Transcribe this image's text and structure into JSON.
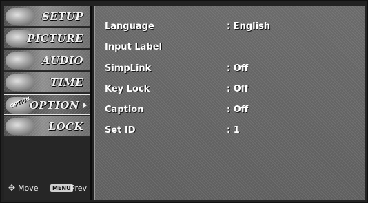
{
  "sidebar": {
    "items": [
      {
        "label": "SETUP"
      },
      {
        "label": "PICTURE"
      },
      {
        "label": "AUDIO"
      },
      {
        "label": "TIME"
      },
      {
        "label": "OPTION",
        "active": true,
        "thumb_text": "OPTION"
      },
      {
        "label": "LOCK"
      }
    ],
    "hints": {
      "move_label": "Move",
      "menu_key": "MENU",
      "prev_label": "Prev"
    }
  },
  "settings": [
    {
      "label": "Language",
      "value": ": English"
    },
    {
      "label": "Input Label",
      "value": ""
    },
    {
      "label": "SimpLink",
      "value": ": Off"
    },
    {
      "label": "Key Lock",
      "value": ": Off"
    },
    {
      "label": "Caption",
      "value": ": Off"
    },
    {
      "label": "Set ID",
      "value": ": 1"
    }
  ],
  "icons": {
    "move": "four-way-arrow-icon",
    "submenu": "triangle-right-icon"
  }
}
